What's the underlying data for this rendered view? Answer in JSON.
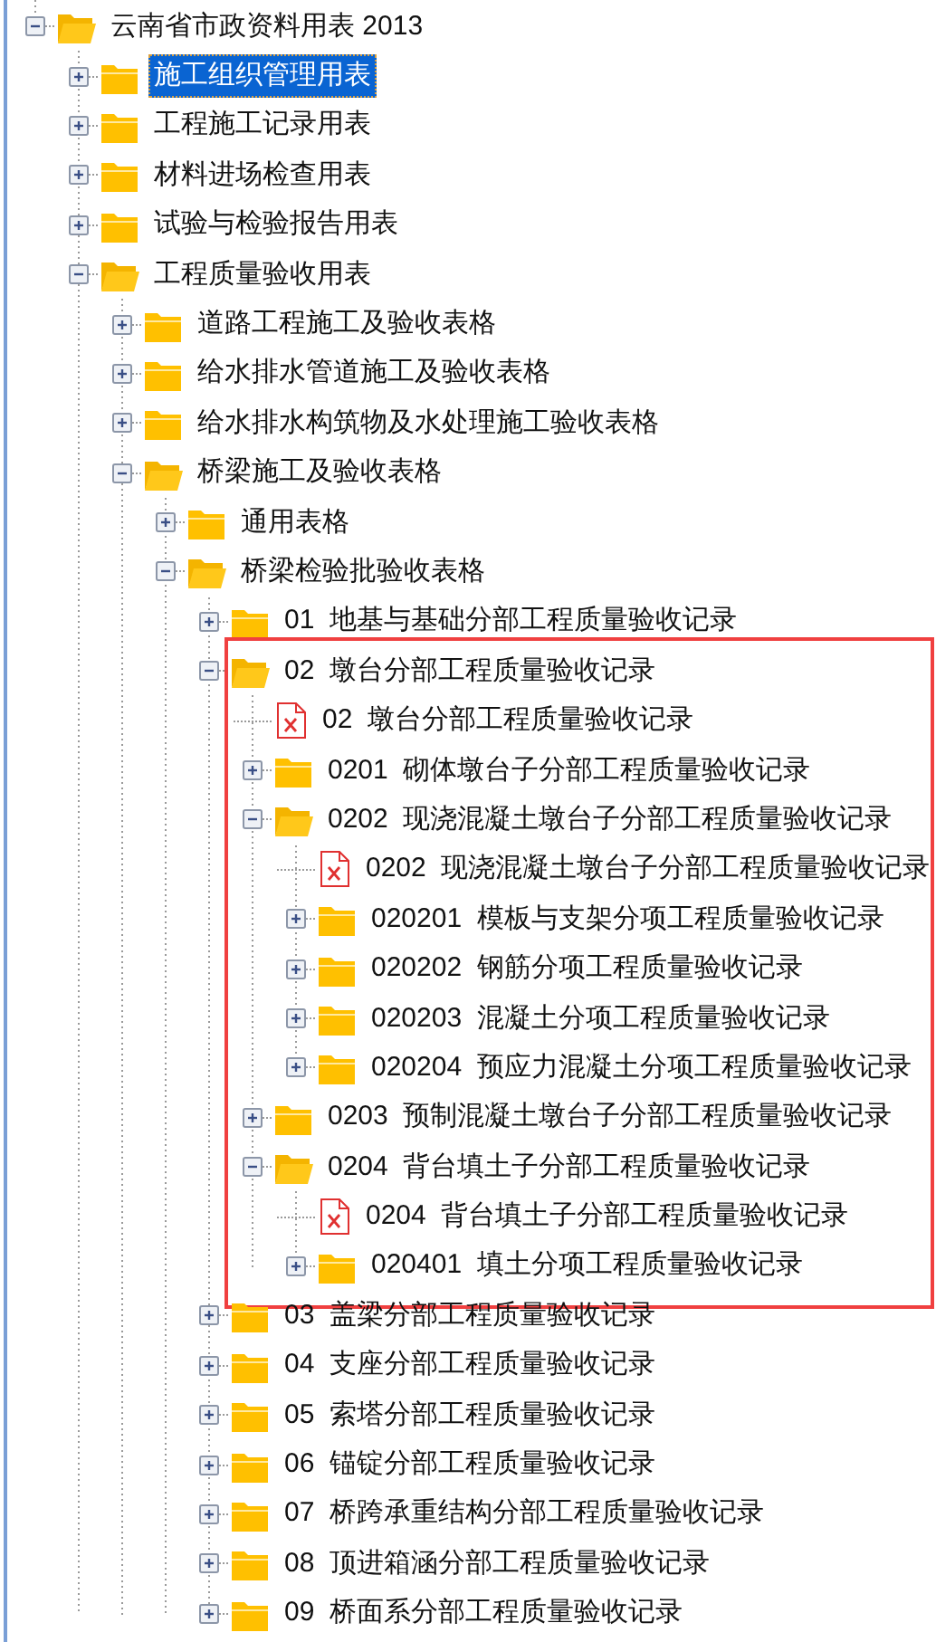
{
  "tree": [
    {
      "kind": "folder",
      "label": "云南省市政资料用表 2013",
      "expanded": true,
      "selected": false,
      "children": [
        {
          "kind": "folder",
          "label": "施工组织管理用表",
          "expanded": false,
          "selected": true
        },
        {
          "kind": "folder",
          "label": "工程施工记录用表",
          "expanded": false,
          "selected": false
        },
        {
          "kind": "folder",
          "label": "材料进场检查用表",
          "expanded": false,
          "selected": false
        },
        {
          "kind": "folder",
          "label": "试验与检验报告用表",
          "expanded": false,
          "selected": false
        },
        {
          "kind": "folder",
          "label": "工程质量验收用表",
          "expanded": true,
          "selected": false,
          "children": [
            {
              "kind": "folder",
              "label": "道路工程施工及验收表格",
              "expanded": false,
              "selected": false
            },
            {
              "kind": "folder",
              "label": "给水排水管道施工及验收表格",
              "expanded": false,
              "selected": false
            },
            {
              "kind": "folder",
              "label": "给水排水构筑物及水处理施工验收表格",
              "expanded": false,
              "selected": false
            },
            {
              "kind": "folder",
              "label": "桥梁施工及验收表格",
              "expanded": true,
              "selected": false,
              "children": [
                {
                  "kind": "folder",
                  "label": "通用表格",
                  "expanded": false,
                  "selected": false
                },
                {
                  "kind": "folder",
                  "label": "桥梁检验批验收表格",
                  "expanded": true,
                  "selected": false,
                  "children": [
                    {
                      "kind": "folder",
                      "label": "01  地基与基础分部工程质量验收记录",
                      "expanded": false,
                      "selected": false
                    },
                    {
                      "kind": "folder",
                      "label": "02  墩台分部工程质量验收记录",
                      "expanded": true,
                      "selected": false,
                      "highlighted": true,
                      "children": [
                        {
                          "kind": "file",
                          "label": "02  墩台分部工程质量验收记录",
                          "selected": false
                        },
                        {
                          "kind": "folder",
                          "label": "0201  砌体墩台子分部工程质量验收记录",
                          "expanded": false,
                          "selected": false
                        },
                        {
                          "kind": "folder",
                          "label": "0202  现浇混凝土墩台子分部工程质量验收记录",
                          "expanded": true,
                          "selected": false,
                          "children": [
                            {
                              "kind": "file",
                              "label": "0202  现浇混凝土墩台子分部工程质量验收记录",
                              "selected": false
                            },
                            {
                              "kind": "folder",
                              "label": "020201  模板与支架分项工程质量验收记录",
                              "expanded": false,
                              "selected": false
                            },
                            {
                              "kind": "folder",
                              "label": "020202  钢筋分项工程质量验收记录",
                              "expanded": false,
                              "selected": false
                            },
                            {
                              "kind": "folder",
                              "label": "020203  混凝土分项工程质量验收记录",
                              "expanded": false,
                              "selected": false
                            },
                            {
                              "kind": "folder",
                              "label": "020204  预应力混凝土分项工程质量验收记录",
                              "expanded": false,
                              "selected": false
                            }
                          ]
                        },
                        {
                          "kind": "folder",
                          "label": "0203  预制混凝土墩台子分部工程质量验收记录",
                          "expanded": false,
                          "selected": false
                        },
                        {
                          "kind": "folder",
                          "label": "0204  背台填土子分部工程质量验收记录",
                          "expanded": true,
                          "selected": false,
                          "children": [
                            {
                              "kind": "file",
                              "label": "0204  背台填土子分部工程质量验收记录",
                              "selected": false
                            },
                            {
                              "kind": "folder",
                              "label": "020401  填土分项工程质量验收记录",
                              "expanded": false,
                              "selected": false
                            }
                          ]
                        }
                      ]
                    },
                    {
                      "kind": "folder",
                      "label": "03  盖梁分部工程质量验收记录",
                      "expanded": false,
                      "selected": false
                    },
                    {
                      "kind": "folder",
                      "label": "04  支座分部工程质量验收记录",
                      "expanded": false,
                      "selected": false
                    },
                    {
                      "kind": "folder",
                      "label": "05  索塔分部工程质量验收记录",
                      "expanded": false,
                      "selected": false
                    },
                    {
                      "kind": "folder",
                      "label": "06  锚锭分部工程质量验收记录",
                      "expanded": false,
                      "selected": false
                    },
                    {
                      "kind": "folder",
                      "label": "07  桥跨承重结构分部工程质量验收记录",
                      "expanded": false,
                      "selected": false
                    },
                    {
                      "kind": "folder",
                      "label": "08  顶进箱涵分部工程质量验收记录",
                      "expanded": false,
                      "selected": false
                    },
                    {
                      "kind": "folder",
                      "label": "09  桥面系分部工程质量验收记录",
                      "expanded": false,
                      "selected": false
                    }
                  ]
                }
              ]
            }
          ]
        }
      ]
    }
  ]
}
